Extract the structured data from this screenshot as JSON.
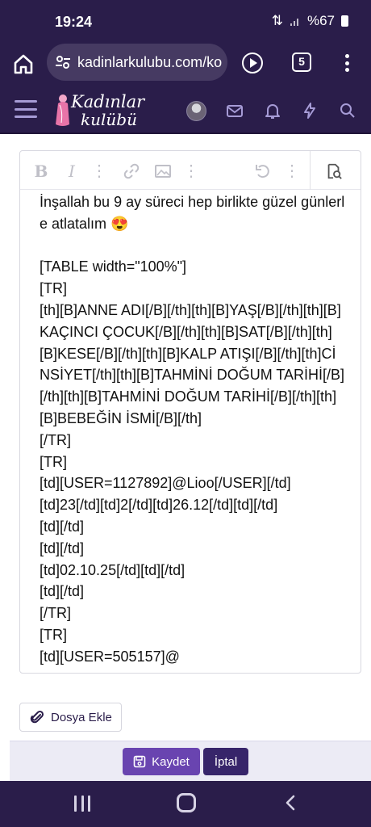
{
  "status_bar": {
    "time": "19:24",
    "battery": "%67"
  },
  "browser": {
    "url": "kadinlarkulubu.com/ko",
    "tab_count": "5"
  },
  "site": {
    "logo_line1": "Kadınlar",
    "logo_line2": "kulübü"
  },
  "editor": {
    "content": "İnşallah bu 9 ay süreci hep birlikte güzel günlerle atlatalım 😍\n\n[TABLE width=\"100%\"]\n[TR]\n[th][B]ANNE ADI[/B][/th][th][B]YAŞ[/B][/th][th][B]KAÇINCI ÇOCUK[/B][/th][th][B]SAT[/B][/th][th][B]KESE[/B][/th][th][B]KALP ATIŞI[/B][/th][th]CİNSİYET[/th][th][B]TAHMİNİ DOĞUM TARİHİ[/B][/th][th][B]TAHMİNİ DOĞUM TARİHİ[/B][/th][th][B]BEBEĞİN İSMİ[/B][/th]\n[/TR]\n[TR]\n[td][USER=1127892]@Lioo[/USER][/td]\n[td]23[/td][td]2[/td][td]26.12[/td][td][/td]\n[td][/td]\n[td][/td]\n[td]02.10.25[/td][td][/td]\n[td][/td]\n[/TR]\n[TR]\n[td][USER=505157]@"
  },
  "buttons": {
    "attach": "Dosya Ekle",
    "save": "Kaydet",
    "cancel": "İptal"
  },
  "icons": {
    "toolbar": [
      "bold-icon",
      "italic-icon",
      "more-icon",
      "link-icon",
      "image-icon",
      "more-icon",
      "undo-icon",
      "more-icon",
      "preview-icon"
    ],
    "header": [
      "menu-icon",
      "avatar",
      "mail-icon",
      "bell-icon",
      "bolt-icon",
      "search-icon"
    ]
  },
  "colors": {
    "header_bg": "#2a1d4a",
    "accent": "#6944b0",
    "cancel_bg": "#37256a"
  }
}
